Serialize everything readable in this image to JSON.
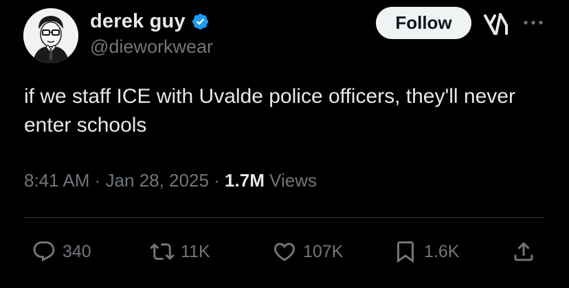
{
  "author": {
    "display_name": "derek guy",
    "handle": "@dieworkwear",
    "verified": true
  },
  "follow_button": {
    "label": "Follow"
  },
  "header_icons": [
    "grok-icon",
    "more-icon"
  ],
  "tweet": {
    "text": "if we staff ICE with Uvalde police officers, they'll never enter schools",
    "time": "8:41 AM",
    "separator": "·",
    "date": "Jan 28, 2025",
    "views_count": "1.7M",
    "views_label": "Views"
  },
  "actions": {
    "replies": {
      "icon": "reply-icon",
      "count": "340"
    },
    "retweets": {
      "icon": "retweet-icon",
      "count": "11K"
    },
    "likes": {
      "icon": "heart-icon",
      "count": "107K"
    },
    "bookmarks": {
      "icon": "bookmark-icon",
      "count": "1.6K"
    },
    "share": {
      "icon": "share-icon"
    }
  },
  "colors": {
    "background": "#000000",
    "primary_text": "#e7e9ea",
    "secondary_text": "#71767b",
    "verified_badge": "#1d9bf0",
    "follow_bg": "#eff3f4",
    "divider": "#2f3336"
  }
}
